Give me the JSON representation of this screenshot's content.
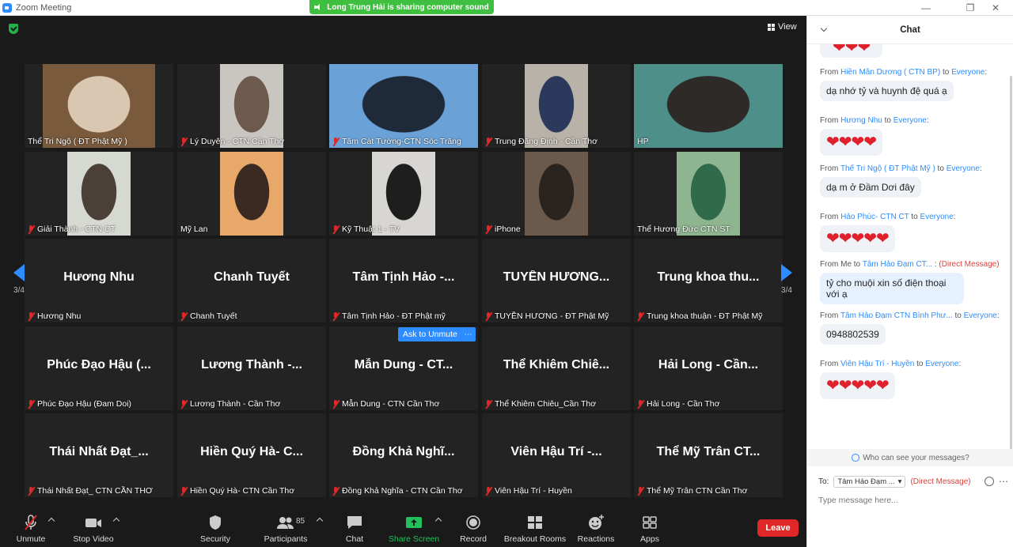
{
  "window": {
    "title": "Zoom Meeting",
    "sharing_banner": "Long Trung Hải is sharing computer sound"
  },
  "view_label": "View",
  "page_indicator": "3/4",
  "ask_unmute_label": "Ask to Unmute",
  "more_label": "⋯",
  "video_tiles": [
    {
      "name": "Thể Tri Ngộ ( ĐT Phật Mỹ )",
      "muted": false,
      "bg": "#7a5a3c",
      "fg": "#d9c7b2"
    },
    {
      "name": "Lý Duyên - CTN Cần Thơ",
      "muted": true,
      "bg": "#c9c6c2",
      "fg": "#6e5a4c"
    },
    {
      "name": "Tâm Cát Tường-CTN Sóc Trăng",
      "muted": true,
      "bg": "#6aa2d8",
      "fg": "#1e2a3a"
    },
    {
      "name": "Trung Đăng Định - Cần Thơ",
      "muted": true,
      "bg": "#b9b2a8",
      "fg": "#2b3a5c"
    },
    {
      "name": "HP",
      "muted": false,
      "bg": "#4f8f8a",
      "fg": "#2d2a28"
    },
    {
      "name": "Giải Thành - CTN CT",
      "muted": true,
      "bg": "#d6d8d2",
      "fg": "#4a4038"
    },
    {
      "name": "Mỹ Lan",
      "muted": false,
      "bg": "#e8a86a",
      "fg": "#3b2a22"
    },
    {
      "name": "Kỹ Thuật 1 - TV",
      "muted": true,
      "bg": "#d8d6d2",
      "fg": "#1e1e1e"
    },
    {
      "name": "iPhone",
      "muted": true,
      "bg": "#6b5a4c",
      "fg": "#2a2420"
    },
    {
      "name": "Thể Hương Đức CTN ST",
      "muted": false,
      "bg": "#8fb590",
      "fg": "#2f6a4a"
    }
  ],
  "name_tiles": [
    {
      "big": "Hương Nhu",
      "name": "Hương Nhu"
    },
    {
      "big": "Chanh Tuyết",
      "name": "Chanh Tuyết"
    },
    {
      "big": "Tâm Tịnh Hảo -...",
      "name": "Tâm Tịnh Hảo - ĐT Phật mỹ"
    },
    {
      "big": "TUYỀN HƯƠNG...",
      "name": "TUYỀN HƯƠNG - ĐT Phật Mỹ"
    },
    {
      "big": "Trung khoa thu...",
      "name": "Trung khoa thuận - ĐT Phật Mỹ"
    },
    {
      "big": "Phúc Đạo Hậu (...",
      "name": "Phúc Đạo Hậu (Đam Doi)"
    },
    {
      "big": "Lương Thành -...",
      "name": "Lương Thành - Cần Thơ"
    },
    {
      "big": "Mẫn Dung - CT...",
      "name": "Mẫn Dung - CTN Cần Thơ"
    },
    {
      "big": "Thể Khiêm Chiê...",
      "name": "Thể Khiêm Chiêu_Cần Thơ"
    },
    {
      "big": "Hải Long - Cần...",
      "name": "Hải Long - Cần Thơ"
    },
    {
      "big": "Thái Nhất Đạt_...",
      "name": "Thái Nhất Đạt_ CTN CẦN THƠ"
    },
    {
      "big": "Hiền Quý Hà- C...",
      "name": "Hiền Quý Hà- CTN Cần Thơ"
    },
    {
      "big": "Đồng Khả Nghĩ...",
      "name": "Đồng Khả Nghĩa - CTN Cần Thơ"
    },
    {
      "big": "Viên Hậu Trí  -...",
      "name": "Viên Hậu Trí  - Huyền"
    },
    {
      "big": "Thể Mỹ Trân CT...",
      "name": "Thể Mỹ Trân CTN Cần Thơ"
    }
  ],
  "toolbar": {
    "unmute": "Unmute",
    "stop_video": "Stop Video",
    "security": "Security",
    "participants": "Participants",
    "participants_count": "85",
    "chat": "Chat",
    "share_screen": "Share Screen",
    "record": "Record",
    "breakout_rooms": "Breakout Rooms",
    "reactions": "Reactions",
    "apps": "Apps",
    "leave": "Leave"
  },
  "chat": {
    "title": "Chat",
    "messages": [
      {
        "prefix": "From ",
        "from": "Hiền Mẫn Dương ( CTN BP)",
        "mid": " to ",
        "to": "Everyone",
        "suffix": ":",
        "text": "dạ nhớ tỷ và huynh đệ quá ạ"
      },
      {
        "prefix": "From ",
        "from": "Hương Nhu",
        "mid": " to ",
        "to": "Everyone",
        "suffix": ":",
        "text": "❤❤❤❤"
      },
      {
        "prefix": "From ",
        "from": "Thể Tri Ngộ ( ĐT Phật Mỹ )",
        "mid": " to ",
        "to": "Everyone",
        "suffix": ":",
        "text": "dạ m ở Đầm Dơi đây"
      },
      {
        "prefix": "From ",
        "from": "Hảo Phúc- CTN CT",
        "mid": " to ",
        "to": "Everyone",
        "suffix": ":",
        "text": "❤❤❤❤❤"
      },
      {
        "prefix": "From Me to ",
        "from": "Tâm Hảo Đạm CT...",
        "mid": " : ",
        "to": "",
        "suffix": "(Direct Message)",
        "text": "tỷ cho muội xin số điện thoại với ạ"
      },
      {
        "prefix": "From ",
        "from": "Tâm Hảo Đạm CTN Bình Phư...",
        "mid": "  to ",
        "to": "Everyone",
        "suffix": ":",
        "text": "0948802539"
      },
      {
        "prefix": "From ",
        "from": "Viên Hậu Trí  - Huyền",
        "mid": "  to ",
        "to": "Everyone",
        "suffix": ":",
        "text": "❤❤❤❤❤"
      }
    ],
    "top_hearts": "❤❤❤",
    "who_can_see": "Who can see your messages?",
    "to_label": "To:",
    "to_recipient": "Tâm Hảo Đạm ...",
    "to_dm": "(Direct Message)",
    "input_placeholder": "Type message here..."
  }
}
